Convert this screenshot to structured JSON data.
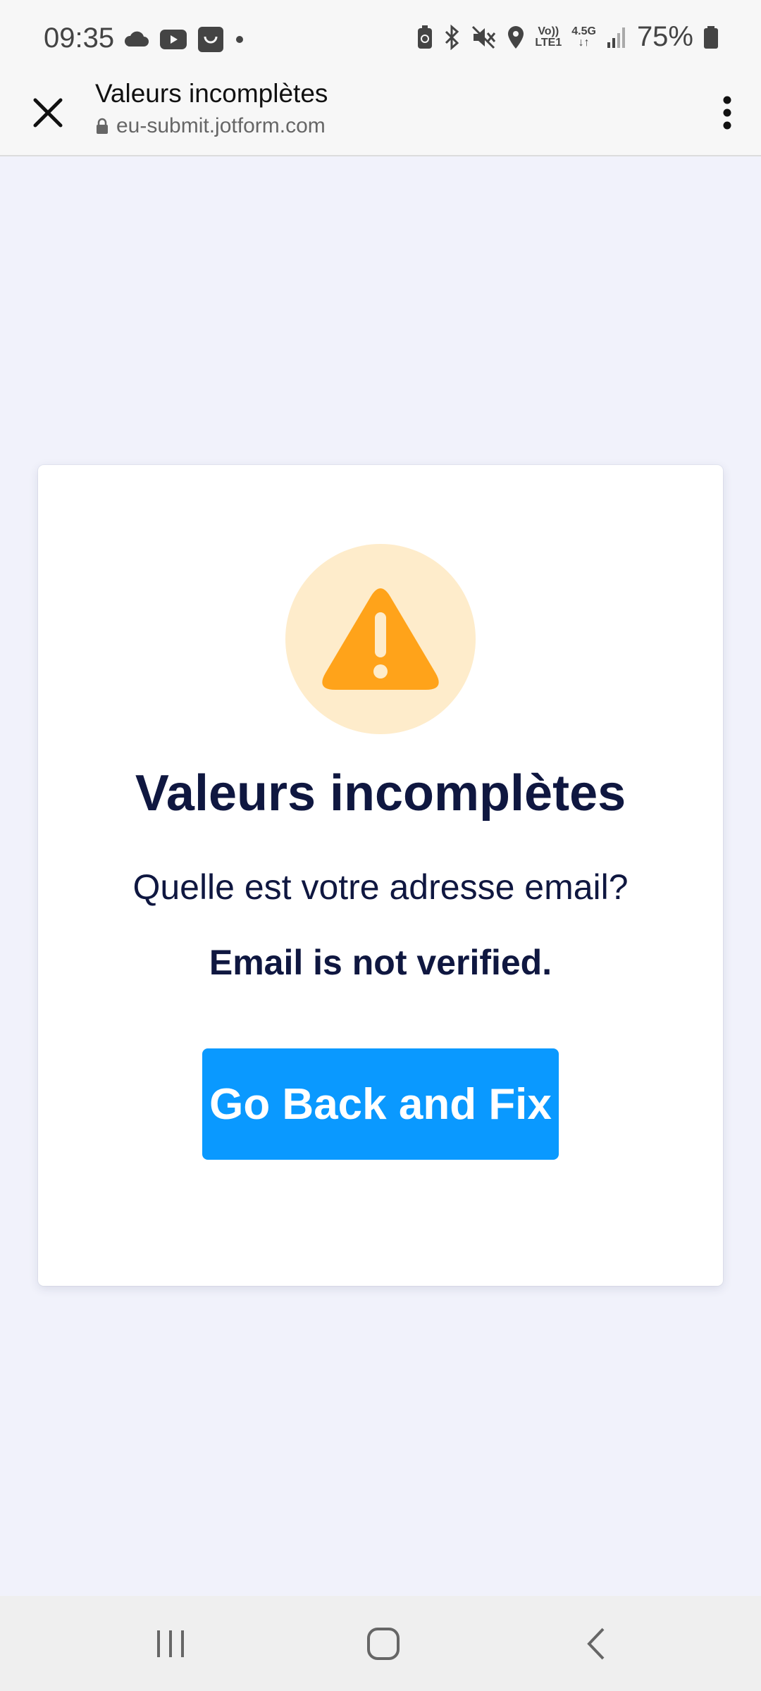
{
  "status_bar": {
    "time": "09:35",
    "left_icons": [
      "cloud-icon",
      "youtube-icon",
      "shopping-bag-icon",
      "dot-icon"
    ],
    "right_icons": [
      "battery-saver-icon",
      "bluetooth-icon",
      "mute-icon",
      "location-icon",
      "volte-icon",
      "signal-icon",
      "battery-icon"
    ],
    "volte_top": "Vo))",
    "volte_bottom": "LTE1",
    "network_top": "4.5G",
    "network_bottom": "↓↑",
    "battery_percent": "75%"
  },
  "browser": {
    "page_title": "Valeurs incomplètes",
    "url": "eu-submit.jotform.com",
    "close_icon": "close-icon",
    "lock_icon": "lock-icon",
    "menu_icon": "more-vert-icon"
  },
  "dialog": {
    "icon": "warning-icon",
    "title": "Valeurs incomplètes",
    "question": "Quelle est votre adresse email?",
    "error": "Email is not verified.",
    "button_label": "Go Back and Fix",
    "colors": {
      "icon_bg": "#feeccb",
      "icon_fg": "#ffa31a",
      "text": "#0f1740",
      "button": "#0a99ff",
      "page_bg": "#f1f2fb"
    }
  },
  "nav_bar": {
    "recents_icon": "recents-icon",
    "home_icon": "home-icon",
    "back_icon": "back-icon"
  }
}
